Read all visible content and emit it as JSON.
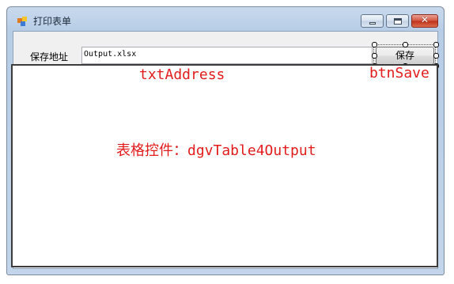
{
  "window": {
    "title": "打印表单"
  },
  "form": {
    "address_label": "保存地址",
    "address_value": "Output.xlsx",
    "save_button_label": "保存"
  },
  "annotations": {
    "txt_address": "txtAddress",
    "btn_save": "btnSave",
    "grid": "表格控件：dgvTable4Output"
  },
  "icons": {
    "app": "form-icon",
    "minimize": "minimize-icon",
    "maximize": "maximize-icon",
    "close": "close-icon"
  },
  "colors": {
    "annotation": "#e31b1b",
    "close_button": "#c73d22",
    "titlebar": "#c3d6eb"
  }
}
